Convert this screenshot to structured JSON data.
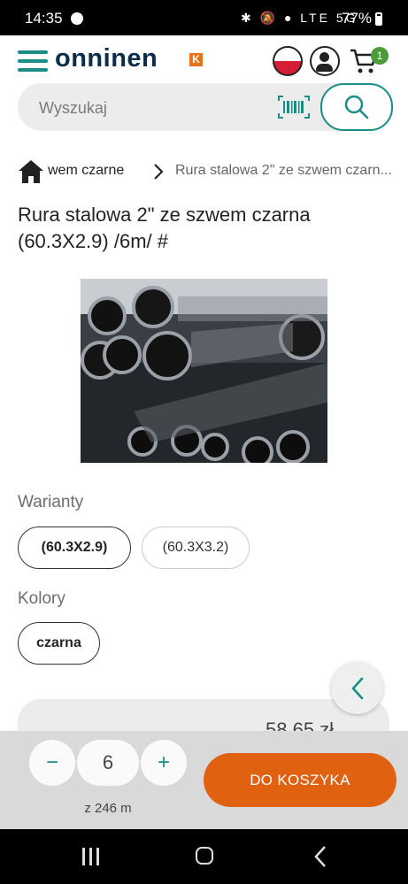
{
  "status_bar": {
    "time": "14:35",
    "indicators": "✱ 🔕 ● LTE 5G",
    "battery": "77%"
  },
  "header": {
    "logo_text": "onninen",
    "logo_badge": "K",
    "cart_count": "1",
    "icons": [
      "menu-icon",
      "flag-pl-icon",
      "user-icon",
      "cart-icon"
    ]
  },
  "search": {
    "placeholder": "Wyszukaj",
    "value": ""
  },
  "breadcrumb": {
    "items": [
      "wem czarne",
      "Rura stalowa 2\" ze szwem czarn..."
    ]
  },
  "product": {
    "title": "Rura stalowa 2\" ze szwem czarna (60.3X2.9) /6m/ #"
  },
  "variants": {
    "label": "Warianty",
    "options": [
      "(60.3X2.9)",
      "(60.3X3.2)"
    ],
    "selected": "(60.3X2.9)"
  },
  "colors": {
    "label": "Kolory",
    "options": [
      "czarna"
    ],
    "selected": "czarna"
  },
  "price": {
    "partial_text": "58,65 zł"
  },
  "actionbar": {
    "minus": "−",
    "plus": "+",
    "quantity": "6",
    "stock": "z 246 m",
    "add_to_cart": "DO KOSZYKA"
  },
  "colors_theme": {
    "brand_teal": "#1a8d86",
    "brand_navy": "#0c2d4a",
    "accent_orange": "#e0610f",
    "badge_green": "#4a9b3a"
  }
}
